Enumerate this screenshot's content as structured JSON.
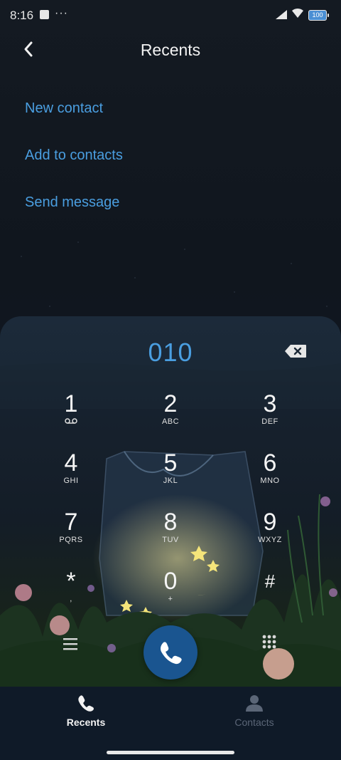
{
  "status_bar": {
    "time": "8:16",
    "battery": "100"
  },
  "header": {
    "title": "Recents"
  },
  "actions": [
    "New contact",
    "Add to contacts",
    "Send message"
  ],
  "dialer": {
    "number": "010",
    "keys": [
      {
        "digit": "1",
        "letters": ""
      },
      {
        "digit": "2",
        "letters": "ABC"
      },
      {
        "digit": "3",
        "letters": "DEF"
      },
      {
        "digit": "4",
        "letters": "GHI"
      },
      {
        "digit": "5",
        "letters": "JKL"
      },
      {
        "digit": "6",
        "letters": "MNO"
      },
      {
        "digit": "7",
        "letters": "PQRS"
      },
      {
        "digit": "8",
        "letters": "TUV"
      },
      {
        "digit": "9",
        "letters": "WXYZ"
      },
      {
        "digit": "*",
        "letters": ","
      },
      {
        "digit": "0",
        "letters": "+"
      },
      {
        "digit": "#",
        "letters": ""
      }
    ]
  },
  "nav": {
    "recents_label": "Recents",
    "contacts_label": "Contacts"
  },
  "colors": {
    "accent": "#4a9ee0",
    "call_button": "#1a5590",
    "background": "#12181f"
  },
  "icons": [
    "back-arrow-icon",
    "voicemail-icon",
    "backspace-icon",
    "menu-icon",
    "phone-icon",
    "dialpad-icon",
    "contact-person-icon"
  ]
}
